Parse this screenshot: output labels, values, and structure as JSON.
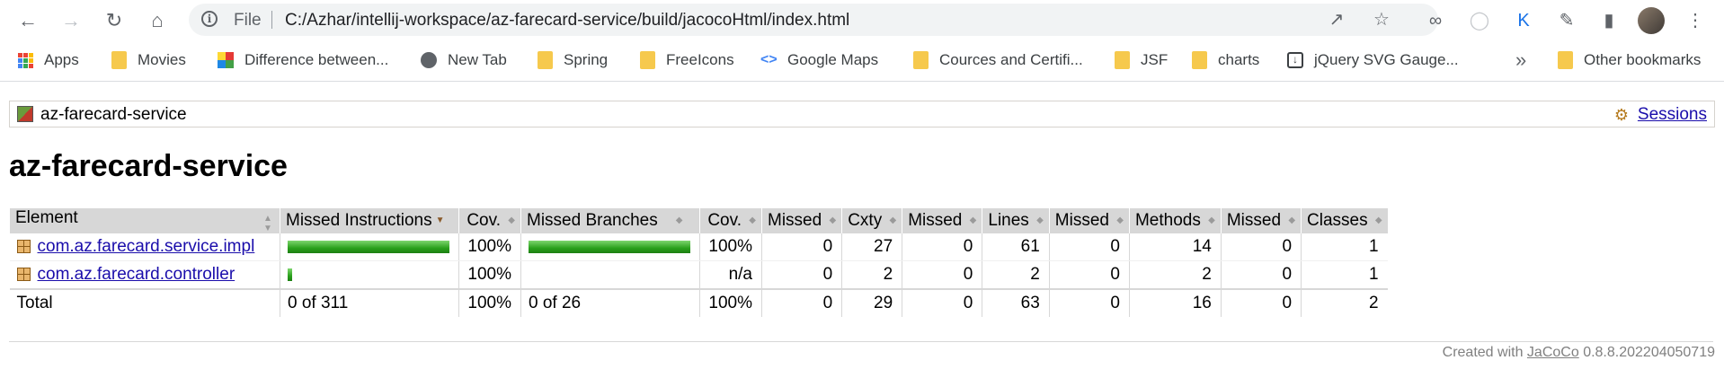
{
  "browser": {
    "omnibox": {
      "scheme_label": "File",
      "url": "C:/Azhar/intellij-workspace/az-farecard-service/build/jacocoHtml/index.html"
    },
    "bookmarks": [
      {
        "label": "Apps",
        "icon": "apps-grid-icon"
      },
      {
        "label": "Movies",
        "icon": "folder-icon"
      },
      {
        "label": "Difference between...",
        "icon": "grid-logo-icon"
      },
      {
        "label": "New Tab",
        "icon": "globe-icon"
      },
      {
        "label": "Spring",
        "icon": "folder-icon"
      },
      {
        "label": "FreeIcons",
        "icon": "folder-icon"
      },
      {
        "label": "Google Maps",
        "icon": "code-icon"
      },
      {
        "label": "Cources and Certifi...",
        "icon": "folder-icon"
      },
      {
        "label": "JSF",
        "icon": "folder-icon"
      },
      {
        "label": "charts",
        "icon": "folder-icon"
      },
      {
        "label": "jQuery SVG Gauge...",
        "icon": "download-icon"
      }
    ],
    "other_bookmarks": "Other bookmarks"
  },
  "breadcrumb": {
    "label": "az-farecard-service",
    "sessions_link": "Sessions"
  },
  "title": "az-farecard-service",
  "table": {
    "headers": [
      "Element",
      "Missed Instructions",
      "Cov.",
      "Missed Branches",
      "Cov.",
      "Missed",
      "Cxty",
      "Missed",
      "Lines",
      "Missed",
      "Methods",
      "Missed",
      "Classes"
    ],
    "rows": [
      {
        "element": "com.az.farecard.service.impl",
        "instr_cov": "100%",
        "instr_fill": 1.0,
        "branch_cov": "100%",
        "branch_fill": 1.0,
        "missed_cxty": "0",
        "cxty": "27",
        "missed_lines": "0",
        "lines": "61",
        "missed_methods": "0",
        "methods": "14",
        "missed_classes": "0",
        "classes": "1"
      },
      {
        "element": "com.az.farecard.controller",
        "instr_cov": "100%",
        "instr_fill": 0.03,
        "branch_cov": "n/a",
        "branch_fill": 0,
        "missed_cxty": "0",
        "cxty": "2",
        "missed_lines": "0",
        "lines": "2",
        "missed_methods": "0",
        "methods": "2",
        "missed_classes": "0",
        "classes": "1"
      }
    ],
    "total": {
      "label": "Total",
      "instr": "0 of 311",
      "instr_cov": "100%",
      "branch": "0 of 26",
      "branch_cov": "100%",
      "missed_cxty": "0",
      "cxty": "29",
      "missed_lines": "0",
      "lines": "63",
      "missed_methods": "0",
      "methods": "16",
      "missed_classes": "0",
      "classes": "2"
    }
  },
  "footer": {
    "prefix": "Created with",
    "link": "JaCoCo",
    "version": "0.8.8.202204050719"
  },
  "colors": {
    "bar_green": "#2aa01c",
    "header_bg": "#d7d7d7",
    "link": "#1a0dab"
  }
}
